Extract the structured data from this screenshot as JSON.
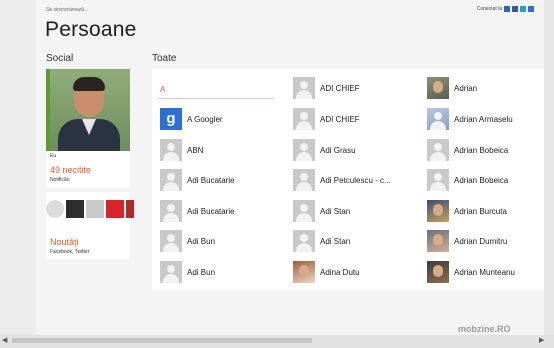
{
  "status": {
    "sync_text": "Se sincronizează...",
    "connected_label": "Conectat la"
  },
  "page": {
    "title": "Persoane"
  },
  "sections": {
    "social": "Social",
    "all": "Toate"
  },
  "me": {
    "label": "Eu",
    "notifications_count": "49 necitite",
    "notifications_label": "Notificări"
  },
  "news": {
    "title": "Noutăți",
    "subtitle": "Facebook, Twitter"
  },
  "list": {
    "letter": "A",
    "columns": [
      [
        {
          "name": "A Googler",
          "avatar": "google"
        },
        {
          "name": "ABN",
          "avatar": "placeholder"
        },
        {
          "name": "Adi Bucatarie",
          "avatar": "placeholder"
        },
        {
          "name": "Adi Bucatarie",
          "avatar": "placeholder"
        },
        {
          "name": "Adi Bun",
          "avatar": "placeholder"
        },
        {
          "name": "Adi Bun",
          "avatar": "placeholder"
        }
      ],
      [
        {
          "name": "ADI CHIEF",
          "avatar": "placeholder"
        },
        {
          "name": "ADI CHIEF",
          "avatar": "placeholder"
        },
        {
          "name": "Adi Grasu",
          "avatar": "placeholder"
        },
        {
          "name": "Adi Petculescu - c...",
          "avatar": "placeholder"
        },
        {
          "name": "Adi Stan",
          "avatar": "placeholder"
        },
        {
          "name": "Adi Stan",
          "avatar": "placeholder"
        },
        {
          "name": "Adina Dutu",
          "avatar": "photo"
        }
      ],
      [
        {
          "name": "Adrian",
          "avatar": "photo"
        },
        {
          "name": "Adrian Armaselu",
          "avatar": "photo"
        },
        {
          "name": "Adrian Bobeica",
          "avatar": "placeholder"
        },
        {
          "name": "Adrian Bobeica",
          "avatar": "placeholder"
        },
        {
          "name": "Adrian Burcuta",
          "avatar": "photo"
        },
        {
          "name": "Adrian Dumitru",
          "avatar": "photo"
        },
        {
          "name": "Adrian Munteanu",
          "avatar": "photo"
        }
      ]
    ]
  },
  "watermark": "mobzine.RO",
  "colors": {
    "accent": "#e05a2a",
    "me_bar": "#5d9b2e"
  }
}
